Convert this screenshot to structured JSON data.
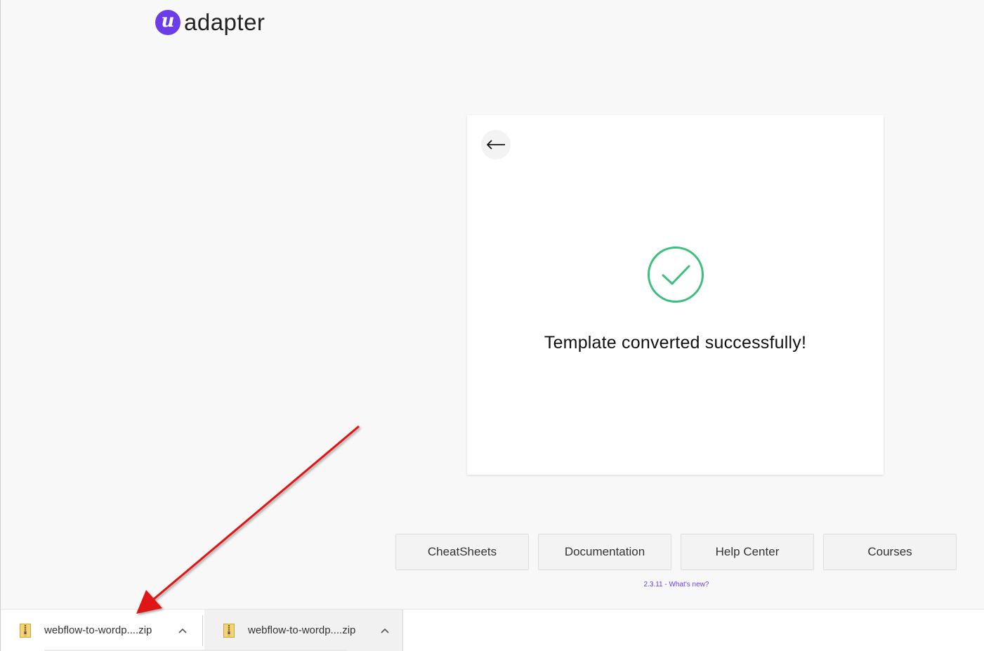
{
  "brand": {
    "logo_letter": "u",
    "name": "adapter",
    "accent_color": "#6b3ce8"
  },
  "card": {
    "back_icon": "arrow-left-icon",
    "status_icon": "check-circle-icon",
    "status_color": "#3dbf7e",
    "message": "Template converted successfully!"
  },
  "footer": {
    "links": [
      {
        "label": "CheatSheets"
      },
      {
        "label": "Documentation"
      },
      {
        "label": "Help Center"
      },
      {
        "label": "Courses"
      }
    ],
    "version": "2.3.11 - What's new?"
  },
  "downloads": [
    {
      "file": "webflow-to-wordp....zip",
      "icon": "zip-file-icon"
    },
    {
      "file": "webflow-to-wordp....zip",
      "icon": "zip-file-icon"
    }
  ],
  "annotation": {
    "arrow_color": "#e01212"
  }
}
